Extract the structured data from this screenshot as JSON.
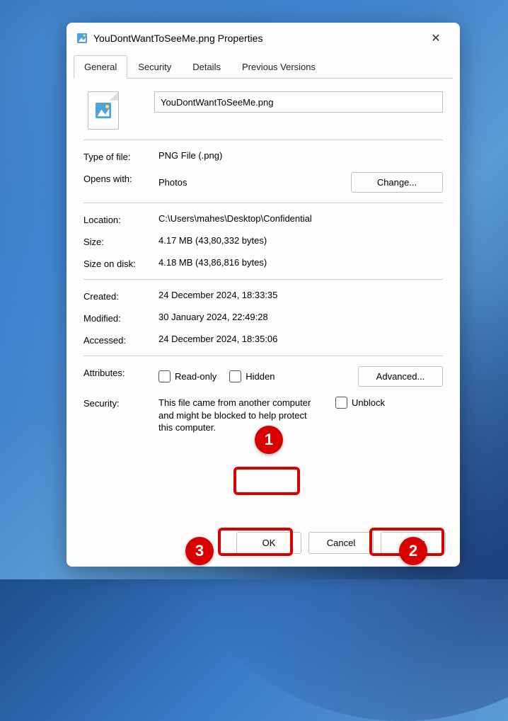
{
  "titlebar": {
    "title": "YouDontWantToSeeMe.png Properties"
  },
  "tabs": {
    "general": "General",
    "security": "Security",
    "details": "Details",
    "previous": "Previous Versions"
  },
  "filename": "YouDontWantToSeeMe.png",
  "labels": {
    "type": "Type of file:",
    "opens": "Opens with:",
    "location": "Location:",
    "size": "Size:",
    "sizeondisk": "Size on disk:",
    "created": "Created:",
    "modified": "Modified:",
    "accessed": "Accessed:",
    "attributes": "Attributes:",
    "security": "Security:"
  },
  "values": {
    "type": "PNG File (.png)",
    "opens": "Photos",
    "location": "C:\\Users\\mahes\\Desktop\\Confidential",
    "size": "4.17 MB (43,80,332 bytes)",
    "sizeondisk": "4.18 MB (43,86,816 bytes)",
    "created": "24 December 2024, 18:33:35",
    "modified": "30 January 2024, 22:49:28",
    "accessed": "24 December 2024, 18:35:06"
  },
  "buttons": {
    "change": "Change...",
    "advanced": "Advanced...",
    "ok": "OK",
    "cancel": "Cancel",
    "apply": "Apply"
  },
  "checkboxes": {
    "readonly": "Read-only",
    "hidden": "Hidden",
    "unblock": "Unblock"
  },
  "security_text": "This file came from another computer and might be blocked to help protect this computer.",
  "annotations": {
    "badge1": "1",
    "badge2": "2",
    "badge3": "3"
  }
}
